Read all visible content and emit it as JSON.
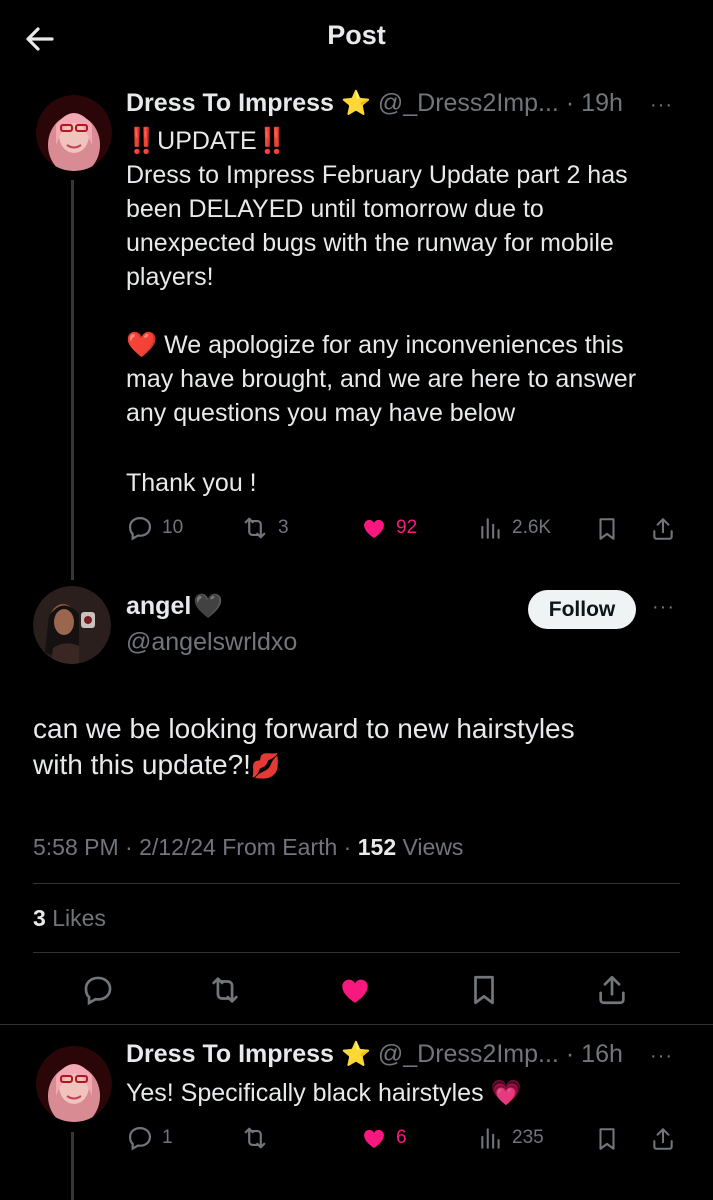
{
  "header": {
    "title": "Post"
  },
  "parent_post": {
    "name": "Dress To Impress",
    "badge": "⭐",
    "handle": "@_Dress2Imp...",
    "separator": "·",
    "time": "19h",
    "more": "···",
    "line1_icons": "‼️",
    "line1_text": "UPDATE",
    "lines": [
      "Dress to Impress February Update part 2 has",
      "been DELAYED until tomorrow due to",
      "unexpected bugs with the runway for mobile",
      "players!"
    ],
    "heart_emoji": "❤️",
    "apology_lines": [
      "We apologize for any inconveniences this",
      "may have brought, and we are here to answer",
      "any questions you may have below"
    ],
    "thanks": "Thank you !",
    "stats": {
      "replies": "10",
      "reposts": "3",
      "likes": "92",
      "views": "2.6K"
    }
  },
  "main_post": {
    "name": "angel",
    "name_emoji": "🖤",
    "handle": "@angelswrldxo",
    "follow_label": "Follow",
    "more": "···",
    "text_line1": "can we be looking forward to new hairstyles",
    "text_line2": "with this update?!",
    "text_emoji": "💋",
    "meta": {
      "time": "5:58 PM",
      "sep1": "·",
      "date": "2/12/24",
      "source": "From Earth",
      "sep2": "·",
      "views_count": "152",
      "views_label": "Views"
    },
    "likes_count": "3",
    "likes_label": "Likes"
  },
  "reply_post": {
    "name": "Dress To Impress",
    "badge": "⭐",
    "handle": "@_Dress2Imp...",
    "separator": "·",
    "time": "16h",
    "more": "···",
    "text": "Yes! Specifically black hairstyles",
    "text_emoji": "💗",
    "stats": {
      "replies": "1",
      "likes": "6",
      "views": "235"
    }
  },
  "colors": {
    "accent_like": "#f91880",
    "muted": "#71767b",
    "text": "#e7e9ea",
    "divider": "#2f3336"
  },
  "icons": [
    "back-arrow-icon",
    "reply-icon",
    "repost-icon",
    "heart-icon",
    "views-icon",
    "bookmark-icon",
    "share-icon",
    "more-icon"
  ]
}
